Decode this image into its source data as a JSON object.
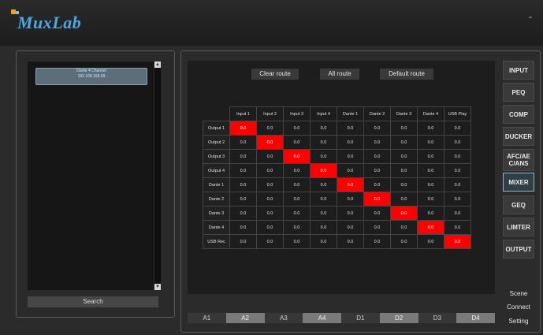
{
  "app": {
    "logo_text": "MuxLab",
    "minimize": "-"
  },
  "left": {
    "device_name": "Dante 4 Channel",
    "device_ip": "192.168.168.99",
    "search_label": "Search"
  },
  "toolbar": {
    "clear": "Clear route",
    "all": "All route",
    "default": "Default route"
  },
  "matrix": {
    "columns": [
      "Input 1",
      "Input 2",
      "Input 3",
      "Input 4",
      "Dante 1",
      "Dante 2",
      "Dante 3",
      "Dante 4",
      "USB Play"
    ],
    "rows": [
      "Output 1",
      "Output 2",
      "Output 3",
      "Output 4",
      "Dante 1",
      "Dante 2",
      "Dante 3",
      "Dante 4",
      "USB Rec"
    ],
    "values": [
      [
        "0.0",
        "0.0",
        "0.0",
        "0.0",
        "0.0",
        "0.0",
        "0.0",
        "0.0",
        "0.0"
      ],
      [
        "0.0",
        "0.0",
        "0.0",
        "0.0",
        "0.0",
        "0.0",
        "0.0",
        "0.0",
        "0.0"
      ],
      [
        "0.0",
        "0.0",
        "0.0",
        "0.0",
        "0.0",
        "0.0",
        "0.0",
        "0.0",
        "0.0"
      ],
      [
        "0.0",
        "0.0",
        "0.0",
        "0.0",
        "0.0",
        "0.0",
        "0.0",
        "0.0",
        "0.0"
      ],
      [
        "0.0",
        "0.0",
        "0.0",
        "0.0",
        "0.0",
        "0.0",
        "0.0",
        "0.0",
        "0.0"
      ],
      [
        "0.0",
        "0.0",
        "0.0",
        "0.0",
        "0.0",
        "0.0",
        "0.0",
        "0.0",
        "0.0"
      ],
      [
        "0.0",
        "0.0",
        "0.0",
        "0.0",
        "0.0",
        "0.0",
        "0.0",
        "0.0",
        "0.0"
      ],
      [
        "0.0",
        "0.0",
        "0.0",
        "0.0",
        "0.0",
        "0.0",
        "0.0",
        "0.0",
        "0.0"
      ],
      [
        "0.0",
        "0.0",
        "0.0",
        "0.0",
        "0.0",
        "0.0",
        "0.0",
        "0.0",
        "0.0"
      ]
    ],
    "active": [
      [
        0,
        0
      ],
      [
        1,
        1
      ],
      [
        2,
        2
      ],
      [
        3,
        3
      ],
      [
        4,
        4
      ],
      [
        5,
        5
      ],
      [
        6,
        6
      ],
      [
        7,
        7
      ],
      [
        8,
        8
      ]
    ],
    "active_color": "#ff0000"
  },
  "sidebar": {
    "buttons": [
      "INPUT",
      "PEQ",
      "COMP",
      "DUCKER",
      "AFC/AE C/ANS",
      "MIXER",
      "GEQ",
      "LIMTER",
      "OUTPUT"
    ],
    "active": "MIXER",
    "scene": "Scene",
    "connect": "Connect",
    "setting": "Setting"
  },
  "tabs": {
    "items": [
      "A1",
      "A2",
      "A3",
      "A4",
      "D1",
      "D2",
      "D3",
      "D4"
    ],
    "active": "A1"
  },
  "colors": {
    "accent": "#49a9e6",
    "route_on": "#ff0000"
  }
}
